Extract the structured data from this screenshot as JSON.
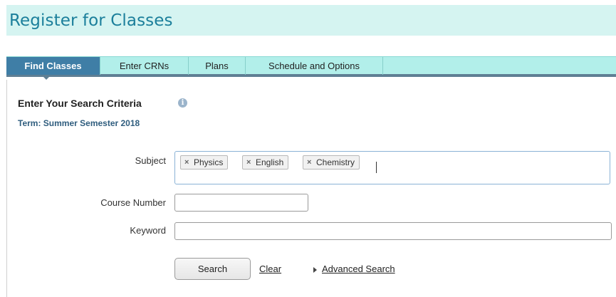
{
  "header": {
    "title": "Register for Classes"
  },
  "tabs": [
    {
      "label": "Find Classes",
      "active": true
    },
    {
      "label": "Enter CRNs",
      "active": false
    },
    {
      "label": "Plans",
      "active": false
    },
    {
      "label": "Schedule and Options",
      "active": false
    }
  ],
  "search": {
    "heading": "Enter Your Search Criteria",
    "info_icon": "info-circle-icon",
    "term": "Term: Summer Semester 2018",
    "subject_label": "Subject",
    "subjects": [
      "Physics",
      "English",
      "Chemistry"
    ],
    "remove_glyph": "×",
    "course_number_label": "Course Number",
    "course_number_value": "",
    "keyword_label": "Keyword",
    "keyword_value": ""
  },
  "actions": {
    "search_label": "Search",
    "clear_label": "Clear",
    "advanced_label": "Advanced Search"
  },
  "colors": {
    "title": "#1b7f9b",
    "title_band": "#d5f4f1",
    "tab_band": "#b2efea",
    "active_tab": "#3f7ea6",
    "term_text": "#2f5d7e"
  }
}
